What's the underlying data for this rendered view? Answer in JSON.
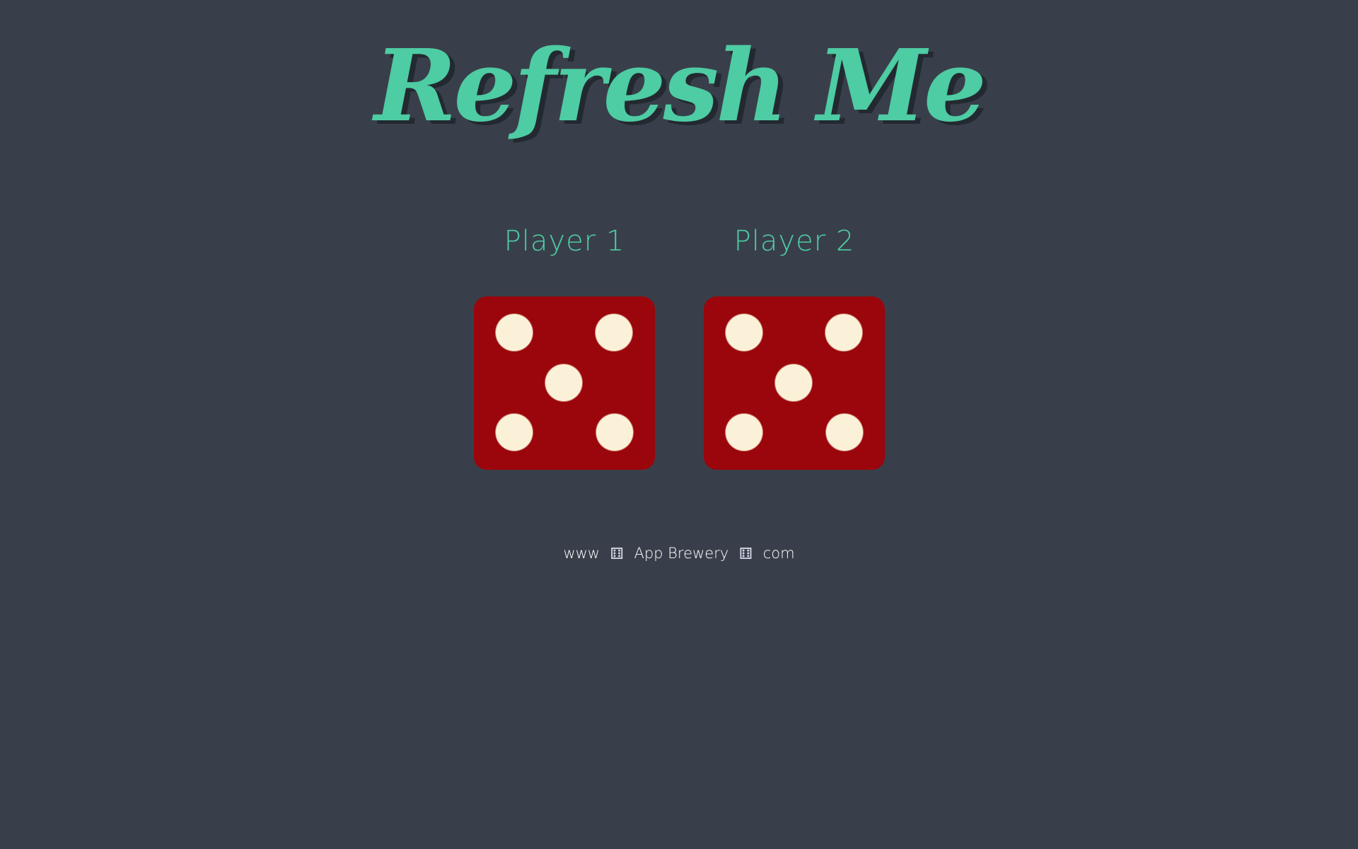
{
  "title": "Refresh Me",
  "players": [
    {
      "label": "Player 1",
      "die_value": 5
    },
    {
      "label": "Player 2",
      "die_value": 5
    }
  ],
  "footer": {
    "part1": "www",
    "part2": "App Brewery",
    "part3": "com",
    "separator_icon": "dice-icon",
    "separator_glyph": "⚅"
  },
  "colors": {
    "background": "#393f4a",
    "accent": "#4ecca3",
    "die_face": "#9b050c",
    "pip": "#fbf1d8"
  }
}
